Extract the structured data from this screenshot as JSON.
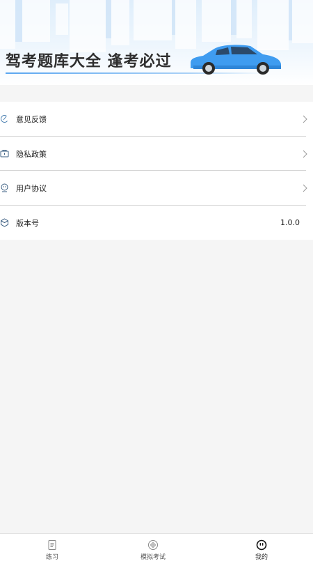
{
  "banner": {
    "title": "驾考题库大全 逢考必过"
  },
  "menu": {
    "items": [
      {
        "label": "意见反馈",
        "icon": "feedback-icon"
      },
      {
        "label": "隐私政策",
        "icon": "privacy-icon"
      },
      {
        "label": "用户协议",
        "icon": "agreement-icon"
      },
      {
        "label": "版本号",
        "icon": "version-icon",
        "value": "1.0.0"
      }
    ]
  },
  "tabbar": {
    "tabs": [
      {
        "label": "练习",
        "icon": "practice-icon"
      },
      {
        "label": "模拟考试",
        "icon": "mock-exam-icon"
      },
      {
        "label": "我的",
        "icon": "profile-icon",
        "active": true
      }
    ]
  },
  "colors": {
    "accent": "#3f9cf0",
    "text": "#222222",
    "background": "#f5f5f5"
  }
}
